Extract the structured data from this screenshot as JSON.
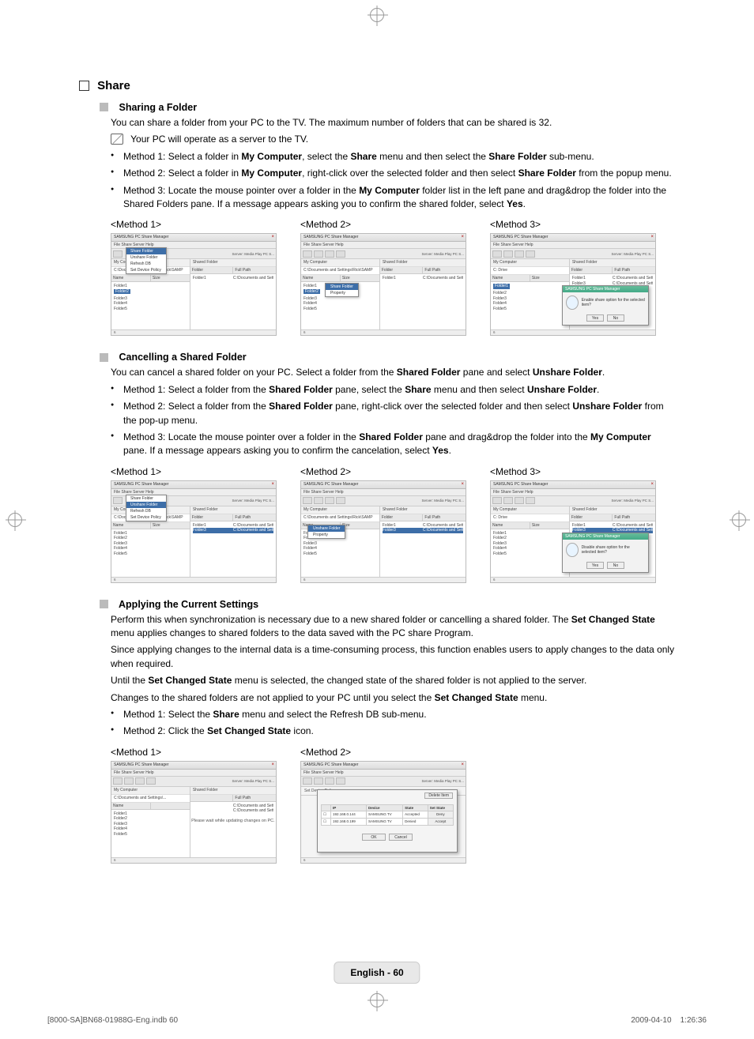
{
  "section_title": "Share",
  "sharing": {
    "heading": "Sharing a Folder",
    "intro": "You can share a folder from your PC to the TV. The maximum number of folders that can be shared is 32.",
    "note": "Your PC will operate as a server to the TV.",
    "m1_a": "Method 1: Select a folder in ",
    "m1_b": "My Computer",
    "m1_c": ", select the ",
    "m1_d": "Share",
    "m1_e": " menu and then select the ",
    "m1_f": "Share Folder",
    "m1_g": " sub-menu.",
    "m2_a": "Method 2: Select a folder in ",
    "m2_b": "My Computer",
    "m2_c": ", right-click over the selected folder and then select ",
    "m2_d": "Share Folder",
    "m2_e": " from the popup menu.",
    "m3_a": "Method 3: Locate the mouse pointer over a folder in the ",
    "m3_b": "My Computer",
    "m3_c": " folder list in the left pane and drag&drop the folder into the Shared Folders pane. If a message appears asking you to confirm the shared folder, select ",
    "m3_d": "Yes",
    "m3_e": ".",
    "method1_label": "<Method 1>",
    "method2_label": "<Method 2>",
    "method3_label": "<Method 3>"
  },
  "cancelling": {
    "heading": "Cancelling a Shared Folder",
    "intro_a": "You can cancel a shared folder on your PC. Select a folder from the ",
    "intro_b": "Shared Folder",
    "intro_c": " pane and select ",
    "intro_d": "Unshare Folder",
    "intro_e": ".",
    "m1_a": "Method 1: Select a folder from the ",
    "m1_b": "Shared Folder",
    "m1_c": " pane, select the ",
    "m1_d": "Share",
    "m1_e": " menu and then select ",
    "m1_f": "Unshare Folder",
    "m1_g": ".",
    "m2_a": "Method 2: Select a folder from the ",
    "m2_b": "Shared Folder",
    "m2_c": " pane, right-click over the selected folder and then select ",
    "m2_d": "Unshare Folder",
    "m2_e": " from the pop-up menu.",
    "m3_a": "Method 3: Locate the mouse pointer over a folder in the ",
    "m3_b": "Shared Folder",
    "m3_c": " pane and drag&drop the folder into the ",
    "m3_d": "My Computer",
    "m3_e": " pane. If a message appears asking you to confirm the cancelation, select ",
    "m3_f": "Yes",
    "m3_g": ".",
    "method1_label": "<Method 1>",
    "method2_label": "<Method 2>",
    "method3_label": "<Method 3>"
  },
  "applying": {
    "heading": "Applying the Current Settings",
    "p1_a": "Perform this when synchronization is necessary due to a new shared folder or cancelling a shared folder. The ",
    "p1_b": "Set Changed State",
    "p1_c": " menu applies changes to shared folders to the data saved with the PC share Program.",
    "p2": "Since applying changes to the internal data is a time-consuming process, this function enables users to apply changes to the data only when required.",
    "p3_a": "Until the ",
    "p3_b": "Set Changed State",
    "p3_c": " menu is selected, the changed state of the shared folder is not applied to the server.",
    "p4_a": "Changes to the shared folders are not applied to your PC until you select the ",
    "p4_b": "Set Changed State",
    "p4_c": " menu.",
    "m1_a": "Method 1: Select the ",
    "m1_b": "Share",
    "m1_c": " menu and select the Refresh DB sub-menu.",
    "m2_a": "Method 2: Click the ",
    "m2_b": "Set Changed State",
    "m2_c": " icon.",
    "method1_label": "<Method 1>",
    "method2_label": "<Method 2>"
  },
  "ss": {
    "app_title": "SAMSUNG PC Share Manager",
    "menu": "File   Share   Server   Help",
    "server_label": "Server:",
    "server_value": "Media Play PC S...",
    "my_computer": "My Computer",
    "shared_folder": "Shared Folder",
    "path_bar": "C:\\Documents and Settings\\Rick\\SAMP",
    "drive": "C: Drive",
    "col_name": "Name",
    "col_size": "Size",
    "col_folder": "Folder",
    "col_fullpath": "Full Path",
    "folders_list": [
      "Folder1",
      "Folder2",
      "Folder3",
      "Folder4",
      "Folder5"
    ],
    "shared_rows_folder": [
      "Folder1",
      "Folder3"
    ],
    "shared_rows_path": [
      "C:\\Documents and Settin...",
      "C:\\Documents and Settin..."
    ],
    "share_menu": {
      "item1": "Share Folder",
      "item2": "Unshare Folder",
      "item3": "Refresh DB",
      "item4": "Set Device Policy"
    },
    "context_share": {
      "item1": "Share Folder",
      "item2": "Property"
    },
    "context_unshare": {
      "item1": "Unshare Folder",
      "item2": "Property"
    },
    "dialog": {
      "title": "SAMSUNG PC Share Manager",
      "msg_enable": "Enable share option for the selected item?",
      "msg_disable": "Disable share option for the selected item?",
      "yes": "Yes",
      "no": "No"
    },
    "updating_msg": "Please wait while updating changes on PC.",
    "device_policy": {
      "label": "Set Device Policy",
      "delete_item": "Delete Item",
      "col_ip": "IP",
      "col_device": "Device",
      "col_state": "State",
      "col_setstate": "Set State",
      "row1_ip": "192.168.0.144",
      "row1_dev": "SAMSUNG TV",
      "row1_state": "Accepted",
      "row1_action": "Deny",
      "row2_ip": "192.168.0.199",
      "row2_dev": "SAMSUNG TV",
      "row2_state": "Denied",
      "row2_action": "Accept",
      "ok": "OK",
      "cancel": "Cancel"
    },
    "status_count": "6"
  },
  "footer": "English - 60",
  "imprint_left": "[8000-SA]BN68-01988G-Eng.indb   60",
  "imprint_right": "2009-04-10      1:26:36"
}
